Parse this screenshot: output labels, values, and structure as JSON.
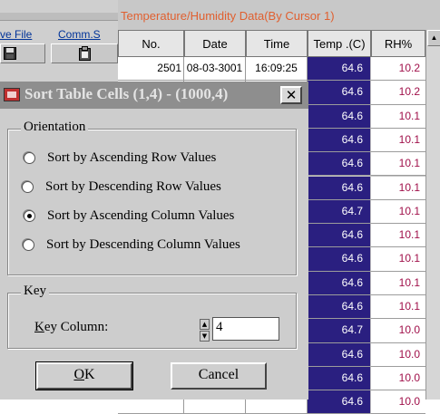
{
  "background_app": {
    "menu": [
      {
        "label": "ve File"
      },
      {
        "label": "Comm.S"
      }
    ],
    "toolbar_icons": [
      "floppy-save-icon",
      "clipboard-paste-icon"
    ],
    "data_panel": {
      "title": "Temperature/Humidity Data(By Cursor 1)",
      "columns": [
        "No.",
        "Date",
        "Time",
        "Temp .(C)",
        "RH%"
      ],
      "rows": [
        {
          "no": "2501",
          "date": "08-03-3001",
          "time": "16:09:25",
          "temp": "64.6",
          "rh": "10.2"
        },
        {
          "no": "",
          "date": "",
          "time": "",
          "temp": "64.6",
          "rh": "10.2"
        },
        {
          "no": "",
          "date": "",
          "time": "",
          "temp": "64.6",
          "rh": "10.1"
        },
        {
          "no": "",
          "date": "",
          "time": "",
          "temp": "64.6",
          "rh": "10.1"
        },
        {
          "no": "",
          "date": "",
          "time": "",
          "temp": "64.6",
          "rh": "10.1"
        },
        {
          "no": "",
          "date": "",
          "time": "",
          "temp": "64.6",
          "rh": "10.1"
        },
        {
          "no": "",
          "date": "",
          "time": "",
          "temp": "64.7",
          "rh": "10.1"
        },
        {
          "no": "",
          "date": "",
          "time": "",
          "temp": "64.6",
          "rh": "10.1"
        },
        {
          "no": "",
          "date": "",
          "time": "",
          "temp": "64.6",
          "rh": "10.1"
        },
        {
          "no": "",
          "date": "",
          "time": "",
          "temp": "64.6",
          "rh": "10.1"
        },
        {
          "no": "",
          "date": "",
          "time": "",
          "temp": "64.6",
          "rh": "10.1"
        },
        {
          "no": "",
          "date": "",
          "time": "",
          "temp": "64.7",
          "rh": "10.0"
        },
        {
          "no": "",
          "date": "",
          "time": "",
          "temp": "64.6",
          "rh": "10.0"
        },
        {
          "no": "",
          "date": "",
          "time": "",
          "temp": "64.6",
          "rh": "10.0"
        },
        {
          "no": "",
          "date": "",
          "time": "",
          "temp": "64.6",
          "rh": "10.0"
        }
      ],
      "colors": {
        "temp_column_bg": "#2a1f80",
        "rh_text": "#a0104a",
        "title_text": "#e06030"
      }
    }
  },
  "dialog": {
    "title": "Sort Table Cells (1,4) - (1000,4)",
    "close_icon": "close-x-icon",
    "orientation": {
      "label": "Orientation",
      "options": [
        {
          "label": "Sort by Ascending Row Values",
          "selected": false
        },
        {
          "label": "Sort by Descending Row Values",
          "selected": false
        },
        {
          "label": "Sort by Ascending Column Values",
          "selected": true
        },
        {
          "label": "Sort by Descending Column Values",
          "selected": false
        }
      ]
    },
    "key": {
      "label": "Key",
      "column_label_mnemonic": "K",
      "column_label_rest": "ey Column:",
      "column_value": "4"
    },
    "ok": {
      "mnemonic": "O",
      "rest": "K"
    },
    "cancel": "Cancel"
  }
}
